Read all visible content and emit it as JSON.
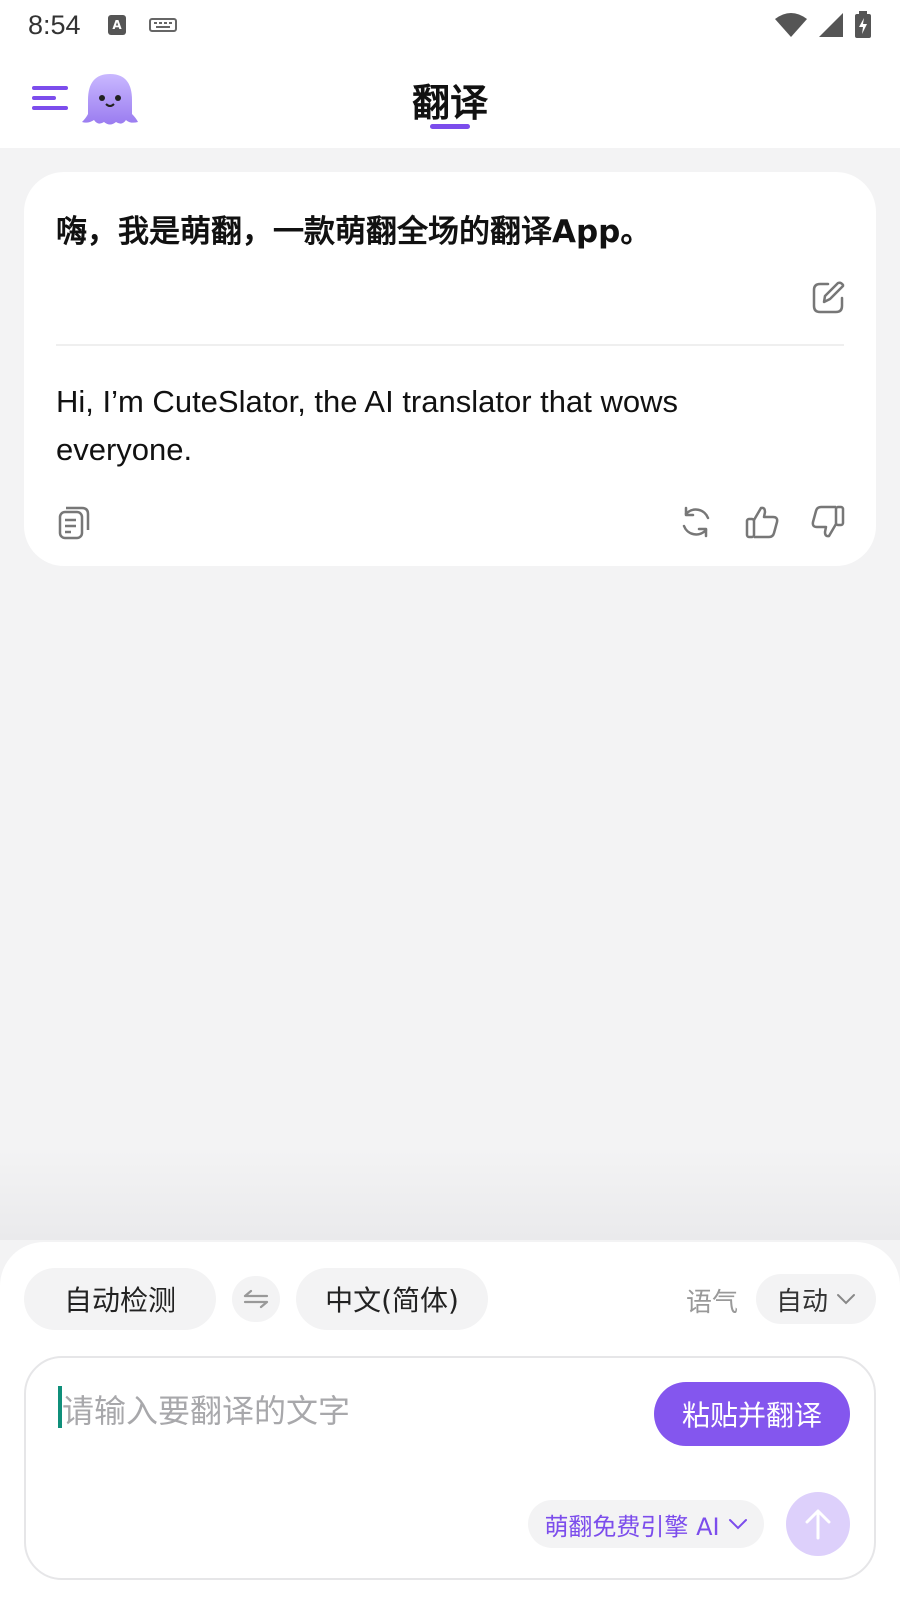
{
  "status_bar": {
    "time": "8:54",
    "icons": [
      "text-input-icon",
      "keyboard-icon",
      "wifi-icon",
      "signal-icon",
      "battery-icon"
    ]
  },
  "header": {
    "title": "翻译",
    "accent_color": "#7c4dec"
  },
  "card": {
    "source_text": "嗨，我是萌翻，一款萌翻全场的翻译App。",
    "translated_text": "Hi, I’m CuteSlator, the AI translator that wows everyone."
  },
  "bottom_panel": {
    "source_language": "自动检测",
    "target_language": "中文(简体)",
    "tone_label": "语气",
    "tone_value": "自动",
    "input_placeholder": "请输入要翻译的文字",
    "paste_button_label": "粘贴并翻译",
    "engine_label": "萌翻免费引擎 AI",
    "button_color": "#8456ee"
  }
}
